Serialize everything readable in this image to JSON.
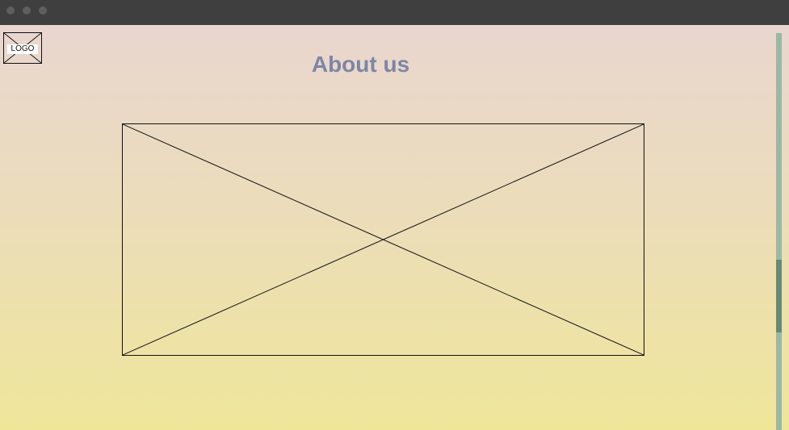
{
  "window": {
    "controls": [
      {
        "name": "close",
        "color": "#5f5f5f"
      },
      {
        "name": "minimize",
        "color": "#5f5f5f"
      },
      {
        "name": "maximize",
        "color": "#5f5f5f"
      }
    ]
  },
  "header": {
    "logo_text": "LOGO",
    "title": "About us"
  },
  "main": {
    "image_placeholder_icon": "x-box-placeholder"
  },
  "colors": {
    "title": "#7e86a4",
    "scrollbar_track": "#9bb8a5",
    "scrollbar_thumb": "#688a73",
    "background_top": "#e9d6cf",
    "background_bottom": "#efe69a"
  }
}
